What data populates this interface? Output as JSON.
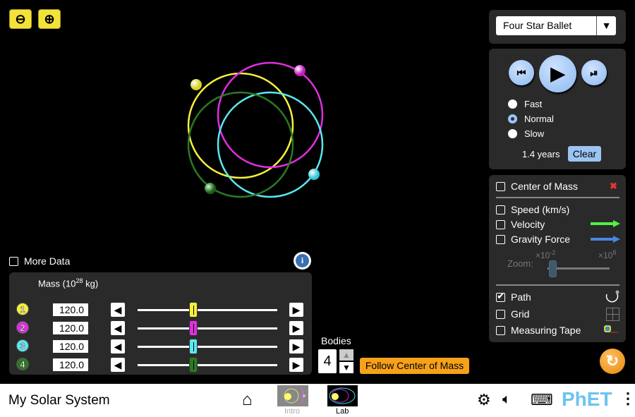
{
  "zoom_controls": {
    "zoom_out": "zoom-out",
    "zoom_in": "zoom-in"
  },
  "scene": {
    "selected": "Four Star Ballet"
  },
  "playback": {
    "speeds": [
      "Fast",
      "Normal",
      "Slow"
    ],
    "selected_speed": "Normal",
    "time": "1.4 years",
    "clear_label": "Clear"
  },
  "visibility": {
    "center_of_mass": "Center of Mass",
    "speed": "Speed (km/s)",
    "velocity": "Velocity",
    "gravity_force": "Gravity Force",
    "zoom_label": "Zoom:",
    "zoom_min": "×10",
    "zoom_min_exp": "-2",
    "zoom_max": "×10",
    "zoom_max_exp": "8",
    "zoom_level": 0.05,
    "path": "Path",
    "grid": "Grid",
    "measuring_tape": "Measuring Tape",
    "path_checked": true,
    "velocity_color": "#55ee44",
    "gravity_color": "#4a86e0"
  },
  "more_data": "More Data",
  "mass_panel": {
    "title_prefix": "Mass (10",
    "title_exp": "28",
    "title_suffix": " kg)",
    "bodies": [
      {
        "num": "1",
        "value": "120.0",
        "color": "#f5f03a",
        "fraction": 0.4
      },
      {
        "num": "2",
        "value": "120.0",
        "color": "#e02ee0",
        "fraction": 0.4
      },
      {
        "num": "3",
        "value": "120.0",
        "color": "#5ae8f0",
        "fraction": 0.4
      },
      {
        "num": "4",
        "value": "120.0",
        "color": "#2a7a22",
        "fraction": 0.4
      }
    ]
  },
  "bodies_control": {
    "label": "Bodies",
    "value": "4"
  },
  "follow_label": "Follow Center of Mass",
  "navbar": {
    "title": "My Solar System",
    "screens": [
      "Intro",
      "Lab"
    ],
    "brand": "PhET"
  }
}
